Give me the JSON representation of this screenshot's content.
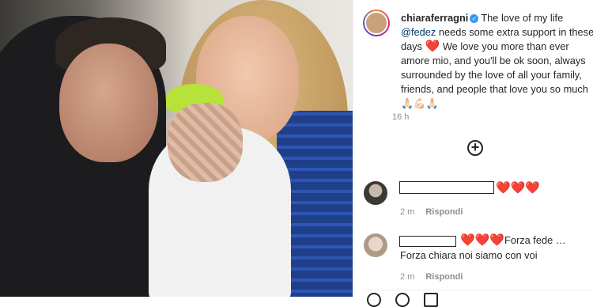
{
  "post": {
    "username": "chiaraferragni",
    "caption_part1": "The love of my life ",
    "mention": "@fedez",
    "caption_part2": " needs some extra support in these days ",
    "caption_heart": "❤️",
    "caption_part3": " We love you more than ever amore mio, and you'll be ok soon, always surrounded by the love of all your family, friends, and people that love you so much ",
    "caption_emojis": "🙏🏻💪🏻🙏🏻",
    "time": "16 h"
  },
  "comments": [
    {
      "hearts": "❤️❤️❤️",
      "time": "2 m",
      "reply": "Rispondi"
    },
    {
      "hearts": "❤️❤️❤️",
      "text": "Forza fede … Forza chiara noi siamo con voi",
      "time": "2 m",
      "reply": "Rispondi"
    }
  ],
  "icons": {
    "verified": "verified-badge-icon",
    "add_comment": "plus-circle-icon",
    "like": "heart-icon",
    "comment": "comment-icon",
    "share": "share-icon"
  },
  "colors": {
    "accent": "#3897f0",
    "heart": "#ed2d3b",
    "muted": "#8e8e8e",
    "mention": "#00376b"
  }
}
